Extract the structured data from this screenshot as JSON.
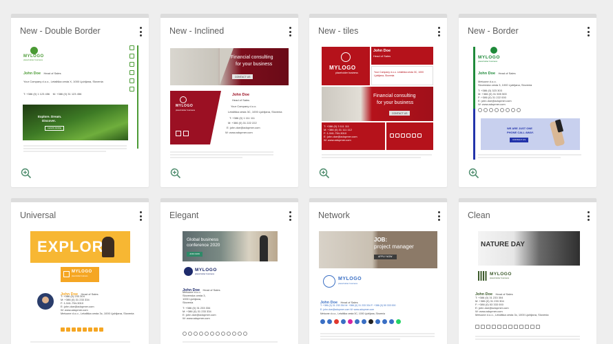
{
  "cards": [
    {
      "title": "New - Double Border",
      "logo": "MYLOGO",
      "tagline": "placeholder business",
      "name": "John Doe",
      "role": "Head of Sales",
      "company": "Your Company d.o.o., Letališka cesta X, 1000 Ljubljana, Slovenia",
      "phone": "T: +386 (0) 1 123 456",
      "mobile": "M: +386 (0) 31 123 456",
      "email": "E: john.doe@adopmer.com",
      "web": "W: www.adopmer.com",
      "banner_line1": "Explore. Dream.",
      "banner_line2": "Discover.",
      "banner_btn": "LEARN MORE",
      "accent": "#4a9a34"
    },
    {
      "title": "New - Inclined",
      "banner_line1": "Financial consulting",
      "banner_line2": "for your business",
      "banner_btn": "CONTACT US",
      "name": "John Doe",
      "role": "Head of Sales",
      "company": "Your Company d.o.o.",
      "address": "Letališka cesta 3C, 1000 Ljubljana, Slovenia",
      "phone": "T: +386 (0) 1 111 111",
      "mobile": "M: +386 (0) 31 222 222",
      "email": "E: john.doe@adopmer.com",
      "web": "W: www.adopmer.com",
      "logo": "MYLOGO",
      "tagline": "placeholder business",
      "accent": "#9b1023"
    },
    {
      "title": "New - tiles",
      "logo": "MYLOGO",
      "tagline": "placeholder business",
      "name": "John Doe",
      "role": "Head of Sales",
      "company": "Your Company d.o.o. Letališka cesta 3C, 1000 Ljubljana, Slovenia",
      "banner_line1": "Financial consulting",
      "banner_line2": "for your business",
      "banner_btn": "CONTACT US",
      "phone": "T: +386 (0) 3 111 111",
      "mobile": "M: +386 (0) 31 111 112",
      "fax": "F: 1-541-754-3010",
      "email": "E: john.doe@adopmer.com",
      "web": "W: www.adopmer.com",
      "accent": "#b5121b"
    },
    {
      "title": "New - Border",
      "logo": "MYLOGO",
      "tagline": "placeholder business",
      "name": "John Doe",
      "role": "Head of Sales",
      "company": "Metuone d.o.o.",
      "address": "Slovenska cesta 3, 1000 Ljubljana, Slovenia",
      "phone": "T: +386 (0) 323 303",
      "mobile": "M: +386 (0) 31 505 500",
      "fax": "F: +386 (0) 31 222 000",
      "email": "E: john.doe@adopmer.com",
      "web": "W: www.adopmer.com",
      "promo_line1": "WE ARE JUST ONE",
      "promo_line2": "PHONE CALL AWAY.",
      "promo_btn": "CONTACT US",
      "accent": "#1f8a3a",
      "accent2": "#2233aa"
    },
    {
      "title": "Universal",
      "banner": "EXPLORE",
      "logo": "MYLOGO",
      "tagline": "placeholder business",
      "name": "John Doe",
      "role": "Head of Sales",
      "phone": "T: +386 (0) 233 304",
      "mobile": "M: +386 (0) 31 233 334",
      "fax": "F: 1-541-754-3010",
      "email": "E: john.doe@adopmer.com",
      "web": "W: www.adopmer.com",
      "address": "Metuone d.o.o., Letališka cesta 3c, 1000 Ljubljana, Slovenia",
      "accent": "#f5a623"
    },
    {
      "title": "Elegant",
      "banner_line1": "Global business",
      "banner_line2": "conference 2020",
      "banner_btn": "JOIN NOW",
      "logo": "MYLOGO",
      "tagline": "placeholder business",
      "name": "John Doe",
      "role": "Head of Sales",
      "company": "Metuone d.o.o.",
      "address1": "Slovenska cesta 3,",
      "address2": "1000 Ljubljana,",
      "address3": "Slovenia",
      "phone": "T: +386 (0) 31 233 334",
      "mobile": "M: +386 (0) 31 233 334",
      "email": "E: john.doe@adopmer.com",
      "web": "W: www.adopmer.com",
      "accent": "#1d2a6b"
    },
    {
      "title": "Network",
      "banner_line1": "JOB:",
      "banner_line2": "project manager",
      "banner_btn": "APPLY NOW",
      "logo": "MYLOGO",
      "tagline": "placeholder business",
      "name": "John Doe",
      "role": "Head of Sales",
      "contacts": "T: +386 (0) 31 233 334   M: +386 (0) 31 233 334   F: +386 (0) 50 333 000",
      "email": "E: john.doe@adopmer.com   W: www.adopmer.com",
      "address": "Metuone d.o.o., Letališka cesta 3C, 1000 Ljubljana, Slovenia",
      "accent": "#8c7a68"
    },
    {
      "title": "Clean",
      "banner": "NATURE DAY",
      "logo": "MYLOGO",
      "tagline": "placeholder business",
      "name": "John Doe",
      "role": "Head of Sales",
      "phone": "T: +386 (0) 31 233 304",
      "mobile": "M: +386 (0) 31 233 304",
      "fax": "F: +386 (0) 53 333 000",
      "email": "E: john.doe@adopmer.com",
      "web": "W: www.adopmer.com",
      "address": "Metuone d.o.o., Letališka cesta 3c, 1000 Ljubljana, Slovenia",
      "accent": "#3b5a2a"
    }
  ],
  "disclaimer": "This message contains confidential information and is intended only for the individual named. If you are not the named addressee you should not disseminate, distribute or copy this e-mail.",
  "icons": {
    "menu": "kebab-menu-icon",
    "zoom": "zoom-in-icon"
  }
}
